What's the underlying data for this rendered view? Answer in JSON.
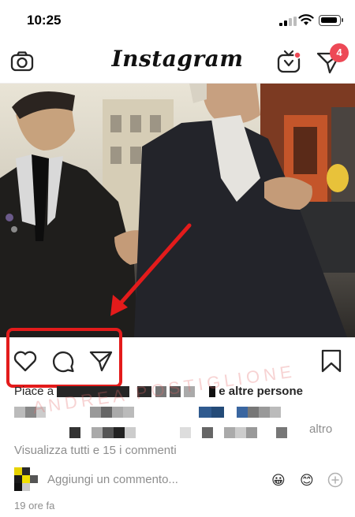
{
  "status_bar": {
    "time": "10:25"
  },
  "header": {
    "logo": "Instagram",
    "camera_icon": "camera-icon",
    "igtv_icon": "igtv-icon",
    "direct_icon": "direct-message-icon",
    "direct_badge": "4"
  },
  "post": {
    "photo_description_icon": "photo",
    "actions": {
      "like_icon": "heart-icon",
      "comment_icon": "comment-icon",
      "share_icon": "share-icon",
      "save_icon": "bookmark-icon"
    },
    "likes_prefix": "Piace a",
    "likes_suffix": "e altre persone",
    "caption_more": "altro",
    "watermark": "ANDREA POSTIGLIONE",
    "view_comments": "Visualizza tutti e 15 i commenti",
    "add_comment_placeholder": "Aggiungi un commento...",
    "emoji_1": "😀",
    "emoji_2": "😊",
    "timestamp": "19 ore fa"
  },
  "colors": {
    "highlight": "#e31b1b",
    "badge": "#ed4956",
    "muted_text": "#8e8e8e"
  }
}
